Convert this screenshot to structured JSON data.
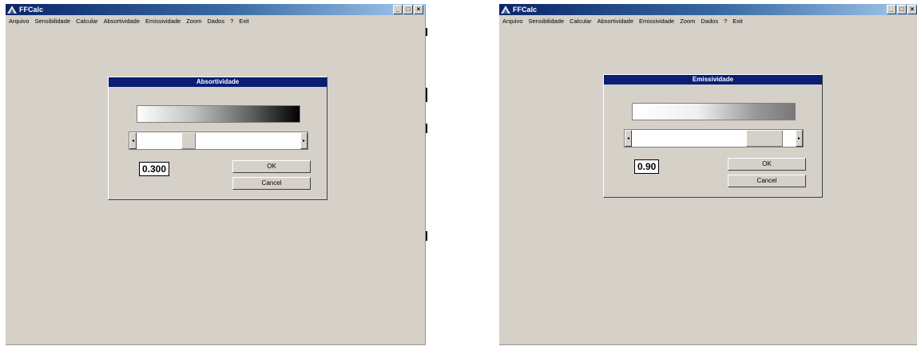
{
  "windows": [
    {
      "title": "FFCalc",
      "menu": [
        "Arquivo",
        "Sensibilidade",
        "Calcular",
        "Absortividade",
        "Emissividade",
        "Zoom",
        "Dados",
        "?",
        "Exit"
      ],
      "dialog": {
        "title": "Absortividade",
        "value": "0.300",
        "ok": "OK",
        "cancel": "Cancel",
        "slider_value": 0.3
      }
    },
    {
      "title": "FFCalc",
      "menu": [
        "Arquivo",
        "Sensibilidade",
        "Calcular",
        "Absortividade",
        "Emissividade",
        "Zoom",
        "Dados",
        "?",
        "Exit"
      ],
      "dialog": {
        "title": "Emissividade",
        "value": "0.90",
        "ok": "OK",
        "cancel": "Cancel",
        "slider_value": 0.9
      }
    }
  ],
  "window_controls": {
    "minimize": "_",
    "maximize": "□",
    "close": "×"
  },
  "scroll_arrows": {
    "left": "◂",
    "right": "▸"
  },
  "icons": {
    "app": "ffcalc-app-icon"
  },
  "colors": {
    "title_bar": "#0a246a",
    "dialog_title_bar": "#0a1e78",
    "face": "#d5d0c8"
  }
}
